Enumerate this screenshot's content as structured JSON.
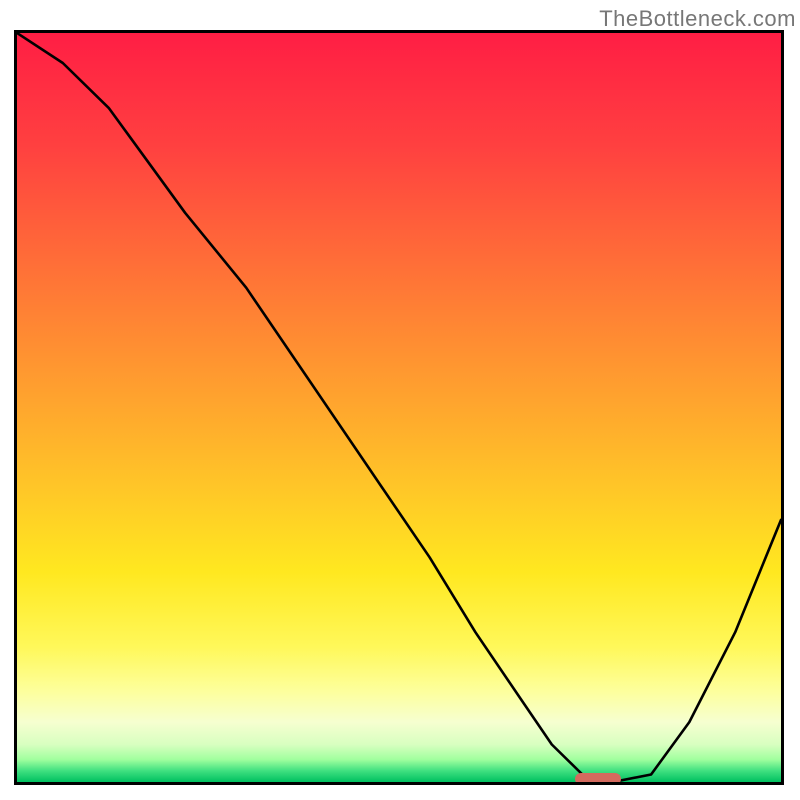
{
  "watermark": "TheBottleneck.com",
  "chart_data": {
    "type": "line",
    "title": "",
    "xlabel": "",
    "ylabel": "",
    "xlim": [
      0,
      100
    ],
    "ylim": [
      0,
      100
    ],
    "series": [
      {
        "name": "bottleneck-curve",
        "x": [
          0,
          6,
          12,
          17,
          22,
          30,
          38,
          46,
          54,
          60,
          66,
          70,
          74,
          78,
          83,
          88,
          94,
          100
        ],
        "values": [
          100,
          96,
          90,
          83,
          76,
          66,
          54,
          42,
          30,
          20,
          11,
          5,
          1,
          0,
          1,
          8,
          20,
          35
        ]
      }
    ],
    "marker": {
      "x": 76,
      "y": 0
    }
  }
}
